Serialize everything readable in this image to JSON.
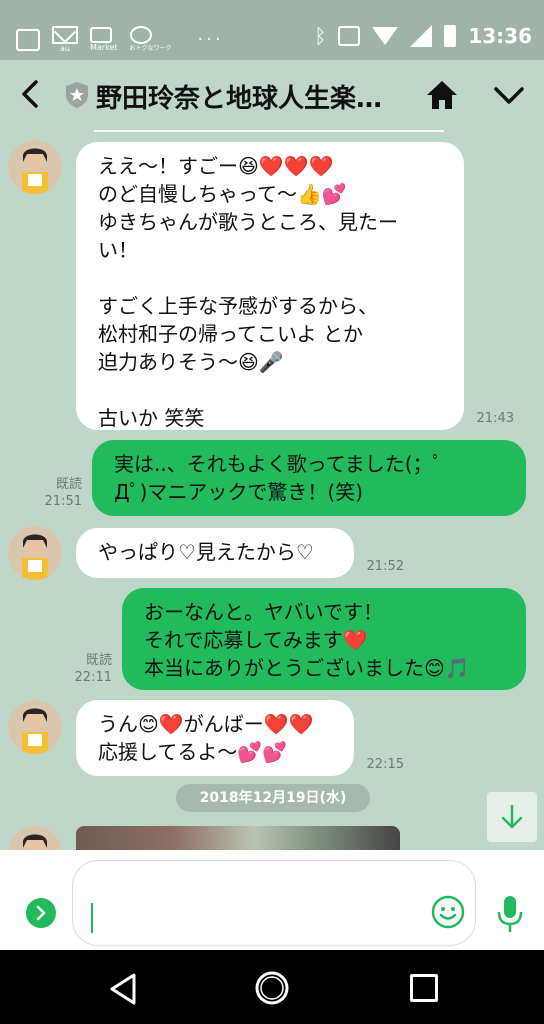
{
  "status_bar": {
    "time": "13:36",
    "left_labels": [
      "au",
      "Market",
      "おトクなワーク"
    ],
    "more": "···"
  },
  "header": {
    "title": "野田玲奈と地球人生楽…"
  },
  "messages": [
    {
      "side": "in",
      "text": "ええ〜！すごー😆❤️❤️❤️\nのど自慢しちゃって〜👍💕\nゆきちゃんが歌うところ、見たー\nい！\n\nすごく上手な予感がするから、\n松村和子の帰ってこいよ とか\n迫力ありそう〜😆🎤\n\n古いか 笑笑",
      "time": "21:43"
    },
    {
      "side": "out",
      "text": "実は..、それもよく歌ってました(；ﾟ\nДﾟ)マニアックで驚き！(笑)",
      "read": "既読",
      "time": "21:51"
    },
    {
      "side": "in",
      "text": "やっぱり♡見えたから♡",
      "time": "21:52"
    },
    {
      "side": "out",
      "text": "おーなんと。ヤバいです！\nそれで応募してみます❤️\n本当にありがとうございました😊🎵",
      "read": "既読",
      "time": "22:11"
    },
    {
      "side": "in",
      "text": "うん😊❤️がんばー❤️❤️\n応援してるよ〜💕💕",
      "time": "22:15"
    }
  ],
  "date_separator": "2018年12月19日(水)",
  "icons": {
    "back": "back-arrow-icon",
    "shield": "shield-star-icon",
    "home": "home-icon",
    "menu": "chevron-down-icon",
    "scroll": "arrow-down-icon",
    "expand": "chevron-right-icon",
    "emoji": "smiley-icon",
    "mic": "microphone-icon"
  },
  "colors": {
    "background": "#bfd7c9",
    "outgoing_bubble": "#22bb5b",
    "incoming_bubble": "#ffffff",
    "accent": "#22bb5b"
  }
}
